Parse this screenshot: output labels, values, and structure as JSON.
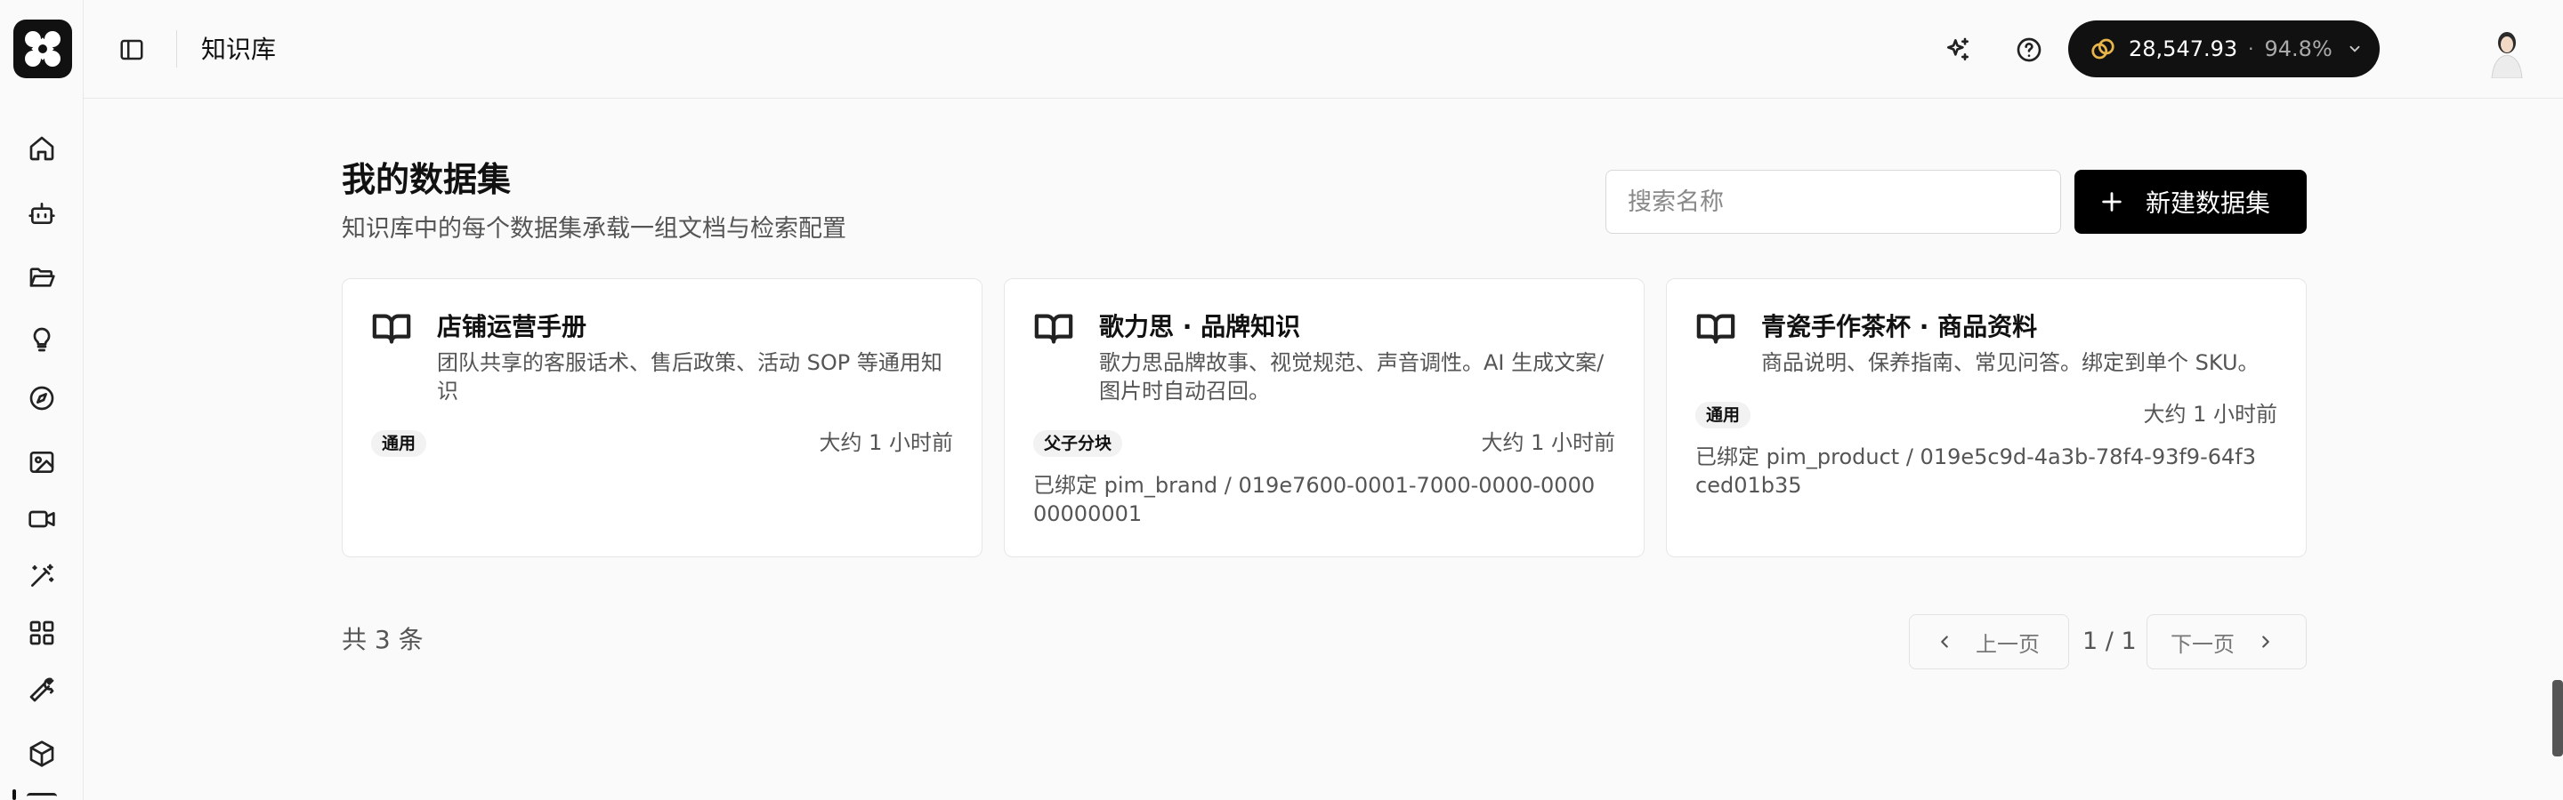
{
  "header": {
    "title": "知识库",
    "credits": {
      "value": "28,547.93",
      "separator": "·",
      "percent": "94.8%"
    }
  },
  "page": {
    "title": "我的数据集",
    "subtitle": "知识库中的每个数据集承载一组文档与检索配置",
    "search_placeholder": "搜索名称",
    "new_button_label": "新建数据集"
  },
  "datasets": [
    {
      "title": "店铺运营手册",
      "description": "团队共享的客服话术、售后政策、活动 SOP 等通用知识",
      "badge": "通用",
      "time": "大约 1 小时前",
      "bound": ""
    },
    {
      "title": "歌力思 · 品牌知识",
      "description": "歌力思品牌故事、视觉规范、声音调性。AI 生成文案/图片时自动召回。",
      "badge": "父子分块",
      "time": "大约 1 小时前",
      "bound": "已绑定 pim_brand / 019e7600-0001-7000-0000-000000000001"
    },
    {
      "title": "青瓷手作茶杯 · 商品资料",
      "description": "商品说明、保养指南、常见问答。绑定到单个 SKU。",
      "badge": "通用",
      "time": "大约 1 小时前",
      "bound": "已绑定 pim_product / 019e5c9d-4a3b-78f4-93f9-64f3ced01b35"
    }
  ],
  "pagination": {
    "total": "共 3 条",
    "prev_label": "上一页",
    "next_label": "下一页",
    "indicator": "1 / 1"
  },
  "sidebar": {
    "icons": [
      "home-icon",
      "bot-icon",
      "folder-open-icon",
      "lightbulb-icon",
      "compass-icon",
      "image-icon",
      "video-icon",
      "magic-wand-icon",
      "grid-icon",
      "wrench-icon",
      "box-icon"
    ]
  },
  "colors": {
    "accent": "#000000",
    "background": "#fafafa",
    "card_border": "#e6e6e6",
    "coin": "#e8b54a"
  }
}
